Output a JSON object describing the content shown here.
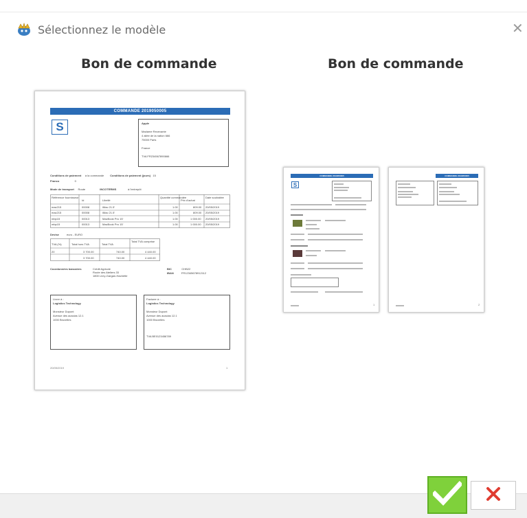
{
  "dialog": {
    "title": "Sélectionnez le modèle",
    "close_glyph": "✕"
  },
  "templates": [
    {
      "heading": "Bon de commande",
      "pages": 1,
      "preview": {
        "bar_title": "COMMANDE 2019050005",
        "logo_letter": "S",
        "recipient": [
          "Apple",
          "Madame Recevante",
          "4 allée de la nation 666",
          "75000 Paris",
          "",
          "France",
          "",
          "TVA        FR234567890666"
        ],
        "payment_label": "Conditions de paiement",
        "payment_value": "à la commande",
        "payment_days_label": "Conditions de paiement (jours)",
        "payment_days_value": "15",
        "franco_label": "Franco",
        "franco_value": "0",
        "transport_label": "Mode de transport",
        "transport_value": "Route",
        "incoterms_label": "INCOTERMS",
        "incoterms_value": "à l'entrepôt",
        "table_headers": [
          "Référence fournisseur",
          "Id",
          "Libellé",
          "Quantité commandée",
          "Prix d'achat",
          "Date souhaitée"
        ],
        "table_rows": [
          [
            "mac215",
            "00008",
            "iMac 21.5'",
            "1.00",
            "809.00",
            "20/05/2019"
          ],
          [
            "mac215",
            "00008",
            "iMac 21.5'",
            "1.00",
            "809.00",
            "20/05/2019"
          ],
          [
            "mbp15",
            "00013",
            "MacBook Pro 15'",
            "1.00",
            "1 000.00",
            "20/05/2019"
          ],
          [
            "mbp15",
            "00013",
            "MacBook Pro 15'",
            "1.00",
            "1 000.00",
            "20/05/2019"
          ]
        ],
        "devise_label": "Devise",
        "devise_value": "euro - EURO",
        "tva_headers": [
          "TVA (%)",
          "Total hors TVA",
          "Total TVA",
          "Total TVA comprise"
        ],
        "tva_rows": [
          [
            "20",
            "3 700.00",
            "740.00",
            "4 440.00"
          ],
          [
            "",
            "3 700.00",
            "740.00",
            "4 440.00"
          ]
        ],
        "bank_label": "Coordonnées bancaires",
        "bank_value": [
          "Crédit Agricole",
          "Route des Ateliers 33",
          "1800 Livry-Gargan-Hachette"
        ],
        "bic_label": "BIC",
        "bic_value": "CHB22",
        "iban_label": "IBAN",
        "iban_value": "FR12345678912112",
        "delivery_box": [
          "Livrer à :",
          "Logistics Technology",
          "",
          "Monsieur Dupont",
          "Avenue des acacias 12.1",
          "1000 Bruxelles"
        ],
        "invoice_box": [
          "Facturer à :",
          "Logistics Technology",
          "",
          "Monsieur Dupont",
          "Avenue des acacias 12.1",
          "1000 Bruxelles"
        ],
        "invoice_tva": "TVA        BE0123456789",
        "footer_date": "20/05/2019",
        "footer_page": "1"
      }
    },
    {
      "heading": "Bon de commande",
      "pages": 2,
      "preview": {
        "bar_title": "COMMANDE 2019050005",
        "logo_letter": "S",
        "footer_page_1": "1",
        "footer_page_2": "2"
      }
    }
  ],
  "buttons": {
    "ok_glyph": "✔",
    "cancel_glyph": "✖"
  },
  "colors": {
    "accent_blue": "#2b6cb6",
    "ok_green": "#7fd13b",
    "cancel_red": "#e03c31"
  }
}
